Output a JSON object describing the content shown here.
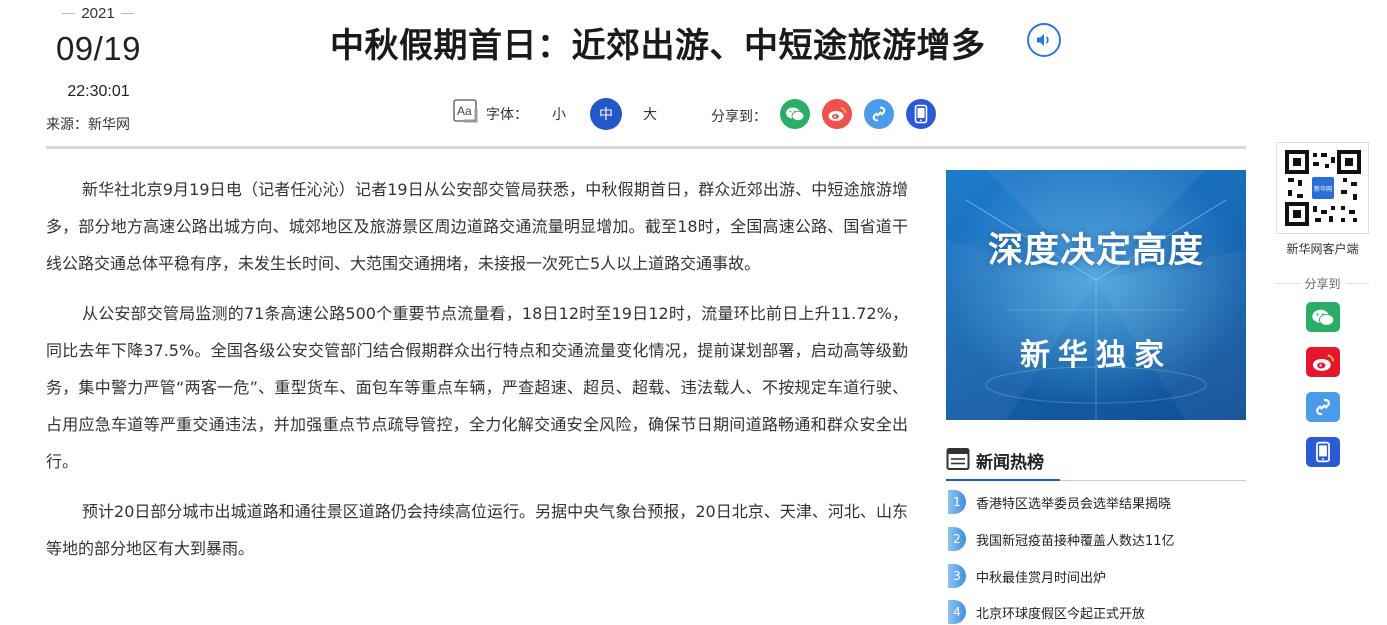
{
  "meta": {
    "year": "2021",
    "date": "09/19",
    "time": "22:30:01",
    "source": "来源：新华网"
  },
  "title": "中秋假期首日：近郊出游、中短途旅游增多",
  "toolbar": {
    "font_label": "字体：",
    "font_sizes": [
      "小",
      "中",
      "大"
    ],
    "active_font_size": "中",
    "share_label": "分享到："
  },
  "article": {
    "paragraphs": [
      "新华社北京9月19日电（记者任沁沁）记者19日从公安部交管局获悉，中秋假期首日，群众近郊出游、中短途旅游增多，部分地方高速公路出城方向、城郊地区及旅游景区周边道路交通流量明显增加。截至18时，全国高速公路、国省道干线公路交通总体平稳有序，未发生长时间、大范围交通拥堵，未接报一次死亡5人以上道路交通事故。",
      "从公安部交管局监测的71条高速公路500个重要节点流量看，18日12时至19日12时，流量环比前日上升11.72%，同比去年下降37.5%。全国各级公安交管部门结合假期群众出行特点和交通流量变化情况，提前谋划部署，启动高等级勤务，集中警力严管“两客一危”、重型货车、面包车等重点车辆，严查超速、超员、超载、违法载人、不按规定车道行驶、占用应急车道等严重交通违法，并加强重点节点疏导管控，全力化解交通安全风险，确保节日期间道路畅通和群众安全出行。",
      "预计20日部分城市出城道路和通往景区道路仍会持续高位运行。另据中央气象台预报，20日北京、天津、河北、山东等地的部分地区有大到暴雨。"
    ]
  },
  "banner": {
    "headline": "深度决定高度",
    "tagline": "新华独家"
  },
  "hot_news": {
    "title": "新闻热榜",
    "items": [
      {
        "rank": "1",
        "text": "香港特区选举委员会选举结果揭晓"
      },
      {
        "rank": "2",
        "text": "我国新冠疫苗接种覆盖人数达11亿"
      },
      {
        "rank": "3",
        "text": "中秋最佳赏月时间出炉"
      },
      {
        "rank": "4",
        "text": "北京环球度假区今起正式开放"
      }
    ]
  },
  "sidebar": {
    "client_label": "新华网客户端",
    "share_label": "分享到",
    "qr_badge": "新华网"
  },
  "colors": {
    "accent": "#2557c8",
    "wechat": "#2aae67",
    "weibo": "#e6162d",
    "link": "#4a9be8",
    "mobile": "#2a5bd7"
  },
  "icons": [
    "speaker-icon",
    "font-size-icon",
    "wechat-icon",
    "weibo-icon",
    "link-icon",
    "mobile-icon",
    "news-list-icon",
    "qr-code"
  ]
}
